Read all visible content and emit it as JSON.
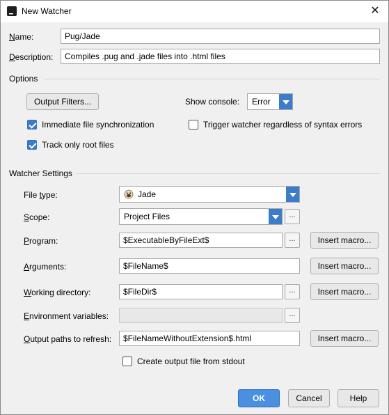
{
  "window": {
    "title": "New Watcher",
    "close_glyph": "✕"
  },
  "name": {
    "label_underlined": "N",
    "label_rest": "ame:",
    "value": "Pug/Jade"
  },
  "description": {
    "label_underlined": "D",
    "label_rest": "escription:",
    "value": "Compiles .pug and .jade files into .html files"
  },
  "options": {
    "heading": "Options",
    "output_filters_button": "Output Filters...",
    "show_console_label": "Show console:",
    "show_console_value": "Error",
    "immediate_sync": {
      "label": "Immediate file synchronization",
      "checked": true
    },
    "trigger_regardless": {
      "label": "Trigger watcher regardless of syntax errors",
      "checked": false
    },
    "track_root": {
      "label": "Track only root files",
      "checked": true
    }
  },
  "watcher_settings": {
    "heading": "Watcher Settings",
    "file_type": {
      "label_pre": "File ",
      "label_u": "t",
      "label_post": "ype:",
      "value": "Jade",
      "icon": "pug-dog-icon"
    },
    "scope": {
      "label_u": "S",
      "label_post": "cope:",
      "value": "Project Files"
    },
    "program": {
      "label_u": "P",
      "label_post": "rogram:",
      "value": "$ExecutableByFileExt$"
    },
    "arguments": {
      "label_u": "A",
      "label_post": "rguments:",
      "value": "$FileName$"
    },
    "working_directory": {
      "label_u": "W",
      "label_post": "orking directory:",
      "value": "$FileDir$"
    },
    "environment_variables": {
      "label_u": "E",
      "label_post": "nvironment variables:",
      "value": ""
    },
    "output_paths": {
      "label_u": "O",
      "label_post": "utput paths to refresh:",
      "value": "$FileNameWithoutExtension$.html"
    },
    "insert_macro_label": "Insert macro...",
    "browse_label": "...",
    "create_output": {
      "label": "Create output file from stdout",
      "checked": false
    }
  },
  "footer": {
    "ok": "OK",
    "cancel": "Cancel",
    "help": "Help"
  },
  "colors": {
    "accent": "#3d7cc9",
    "ok_button": "#4b8fe0"
  }
}
